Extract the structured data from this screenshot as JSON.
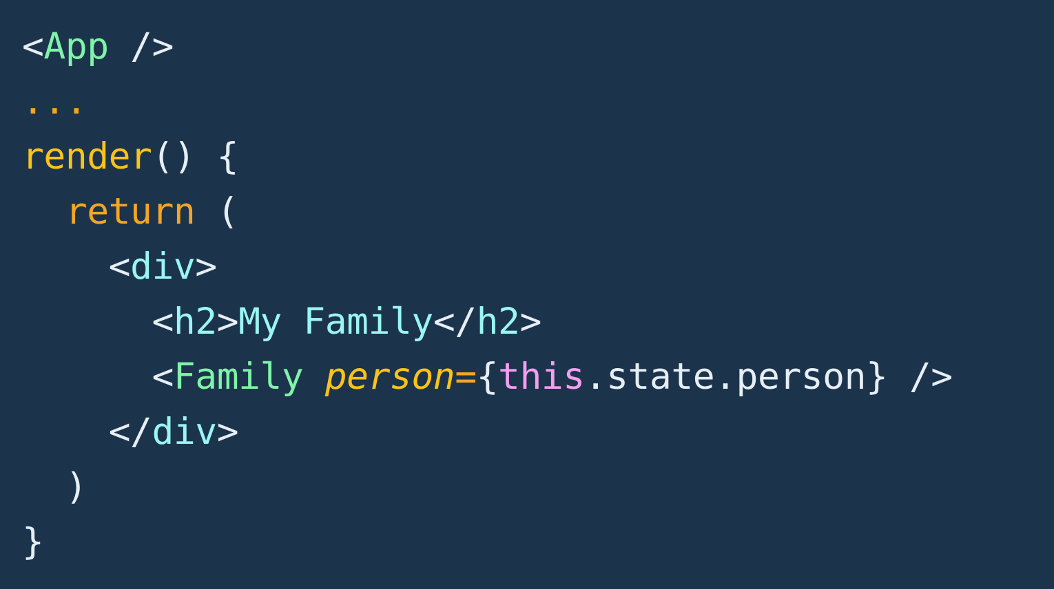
{
  "code": {
    "lines": [
      [
        {
          "text": "<",
          "color": "#e6eef6"
        },
        {
          "text": "App",
          "color": "#7ff3a8"
        },
        {
          "text": " />",
          "color": "#e6eef6"
        }
      ],
      [
        {
          "text": "...",
          "color": "#f5a524"
        }
      ],
      [
        {
          "text": "render",
          "color": "#fbc31a"
        },
        {
          "text": "() {",
          "color": "#e6eef6"
        }
      ],
      [
        {
          "text": "  ",
          "color": "#e6eef6"
        },
        {
          "text": "return",
          "color": "#f5a524"
        },
        {
          "text": " (",
          "color": "#e6eef6"
        }
      ],
      [
        {
          "text": "    ",
          "color": "#e6eef6"
        },
        {
          "text": "<",
          "color": "#e6eef6"
        },
        {
          "text": "div",
          "color": "#9af6f2"
        },
        {
          "text": ">",
          "color": "#e6eef6"
        }
      ],
      [
        {
          "text": "      ",
          "color": "#e6eef6"
        },
        {
          "text": "<",
          "color": "#e6eef6"
        },
        {
          "text": "h2",
          "color": "#9af6f2"
        },
        {
          "text": ">",
          "color": "#e6eef6"
        },
        {
          "text": "My Family",
          "color": "#9af6f2"
        },
        {
          "text": "</",
          "color": "#e6eef6"
        },
        {
          "text": "h2",
          "color": "#9af6f2"
        },
        {
          "text": ">",
          "color": "#e6eef6"
        }
      ],
      [
        {
          "text": "      ",
          "color": "#e6eef6"
        },
        {
          "text": "<",
          "color": "#e6eef6"
        },
        {
          "text": "Family",
          "color": "#7ff3a8"
        },
        {
          "text": " ",
          "color": "#e6eef6"
        },
        {
          "text": "person",
          "color": "#fbc31a",
          "italic": true
        },
        {
          "text": "=",
          "color": "#f5a524"
        },
        {
          "text": "{",
          "color": "#e6eef6"
        },
        {
          "text": "this",
          "color": "#f49ef0"
        },
        {
          "text": ".state.person} />",
          "color": "#e6eef6"
        }
      ],
      [
        {
          "text": "    ",
          "color": "#e6eef6"
        },
        {
          "text": "</",
          "color": "#e6eef6"
        },
        {
          "text": "div",
          "color": "#9af6f2"
        },
        {
          "text": ">",
          "color": "#e6eef6"
        }
      ],
      [
        {
          "text": "  )",
          "color": "#e6eef6"
        }
      ],
      [
        {
          "text": "}",
          "color": "#e6eef6"
        }
      ]
    ]
  },
  "colors": {
    "background": "#1c344b",
    "default_text": "#e6eef6",
    "component_tag": "#7ff3a8",
    "html_tag": "#9af6f2",
    "keyword_orange": "#f5a524",
    "function_yellow": "#fbc31a",
    "this_keyword": "#f49ef0"
  }
}
